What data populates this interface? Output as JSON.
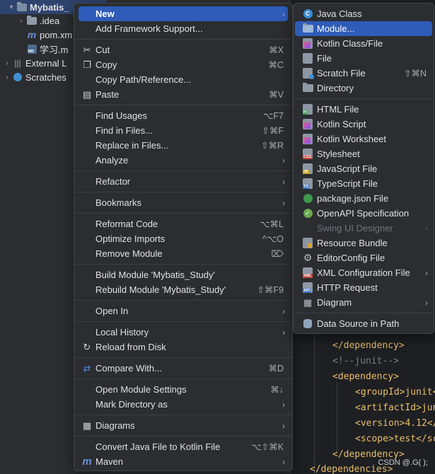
{
  "tree": {
    "items": [
      {
        "label": "Mybatis_"
      },
      {
        "label": ".idea"
      },
      {
        "label": "pom.xm"
      },
      {
        "label": "学习.m"
      },
      {
        "label": "External L"
      },
      {
        "label": "Scratches"
      }
    ]
  },
  "menu": {
    "items": [
      {
        "label": "New"
      },
      {
        "label": "Add Framework Support..."
      },
      {
        "label": "Cut",
        "shortcut": "⌘X"
      },
      {
        "label": "Copy",
        "shortcut": "⌘C"
      },
      {
        "label": "Copy Path/Reference..."
      },
      {
        "label": "Paste",
        "shortcut": "⌘V"
      },
      {
        "label": "Find Usages",
        "shortcut": "⌥F7"
      },
      {
        "label": "Find in Files...",
        "shortcut": "⇧⌘F"
      },
      {
        "label": "Replace in Files...",
        "shortcut": "⇧⌘R"
      },
      {
        "label": "Analyze"
      },
      {
        "label": "Refactor"
      },
      {
        "label": "Bookmarks"
      },
      {
        "label": "Reformat Code",
        "shortcut": "⌥⌘L"
      },
      {
        "label": "Optimize Imports",
        "shortcut": "^⌥O"
      },
      {
        "label": "Remove Module",
        "shortcut": "⌦"
      },
      {
        "label": "Build Module 'Mybatis_Study'"
      },
      {
        "label": "Rebuild Module 'Mybatis_Study'",
        "shortcut": "⇧⌘F9"
      },
      {
        "label": "Open In"
      },
      {
        "label": "Local History"
      },
      {
        "label": "Reload from Disk"
      },
      {
        "label": "Compare With...",
        "shortcut": "⌘D"
      },
      {
        "label": "Open Module Settings",
        "shortcut": "⌘↓"
      },
      {
        "label": "Mark Directory as"
      },
      {
        "label": "Diagrams"
      },
      {
        "label": "Convert Java File to Kotlin File",
        "shortcut": "⌥⇧⌘K"
      },
      {
        "label": "Maven"
      }
    ]
  },
  "submenu": {
    "items": [
      {
        "label": "Java Class"
      },
      {
        "label": "Module..."
      },
      {
        "label": "Kotlin Class/File"
      },
      {
        "label": "File"
      },
      {
        "label": "Scratch File",
        "shortcut": "⇧⌘N"
      },
      {
        "label": "Directory"
      },
      {
        "label": "HTML File"
      },
      {
        "label": "Kotlin Script"
      },
      {
        "label": "Kotlin Worksheet"
      },
      {
        "label": "Stylesheet"
      },
      {
        "label": "JavaScript File"
      },
      {
        "label": "TypeScript File"
      },
      {
        "label": "package.json File"
      },
      {
        "label": "OpenAPI Specification"
      },
      {
        "label": "Swing UI Designer"
      },
      {
        "label": "Resource Bundle"
      },
      {
        "label": "EditorConfig File"
      },
      {
        "label": "XML Configuration File"
      },
      {
        "label": "HTTP Request"
      },
      {
        "label": "Diagram"
      },
      {
        "label": "Data Source in Path"
      }
    ]
  },
  "editor": {
    "lines": [
      {
        "text": "</dependency>"
      },
      {
        "text": "<!--junit-->"
      },
      {
        "text": "<dependency>"
      },
      {
        "text": "<groupId>junit<"
      },
      {
        "text": "<artifactId>jun"
      },
      {
        "text": "<version>4.12</"
      },
      {
        "text": "<scope>test</sc"
      },
      {
        "text": "</dependency>"
      },
      {
        "text": "</dependencies>"
      }
    ],
    "watermark": "CSDN @.G( );"
  },
  "colors": {
    "accent": "#2e5cb8",
    "menu_bg": "#2b2d30",
    "editor_bg": "#1e1f22",
    "tag": "#e8bf6a"
  }
}
